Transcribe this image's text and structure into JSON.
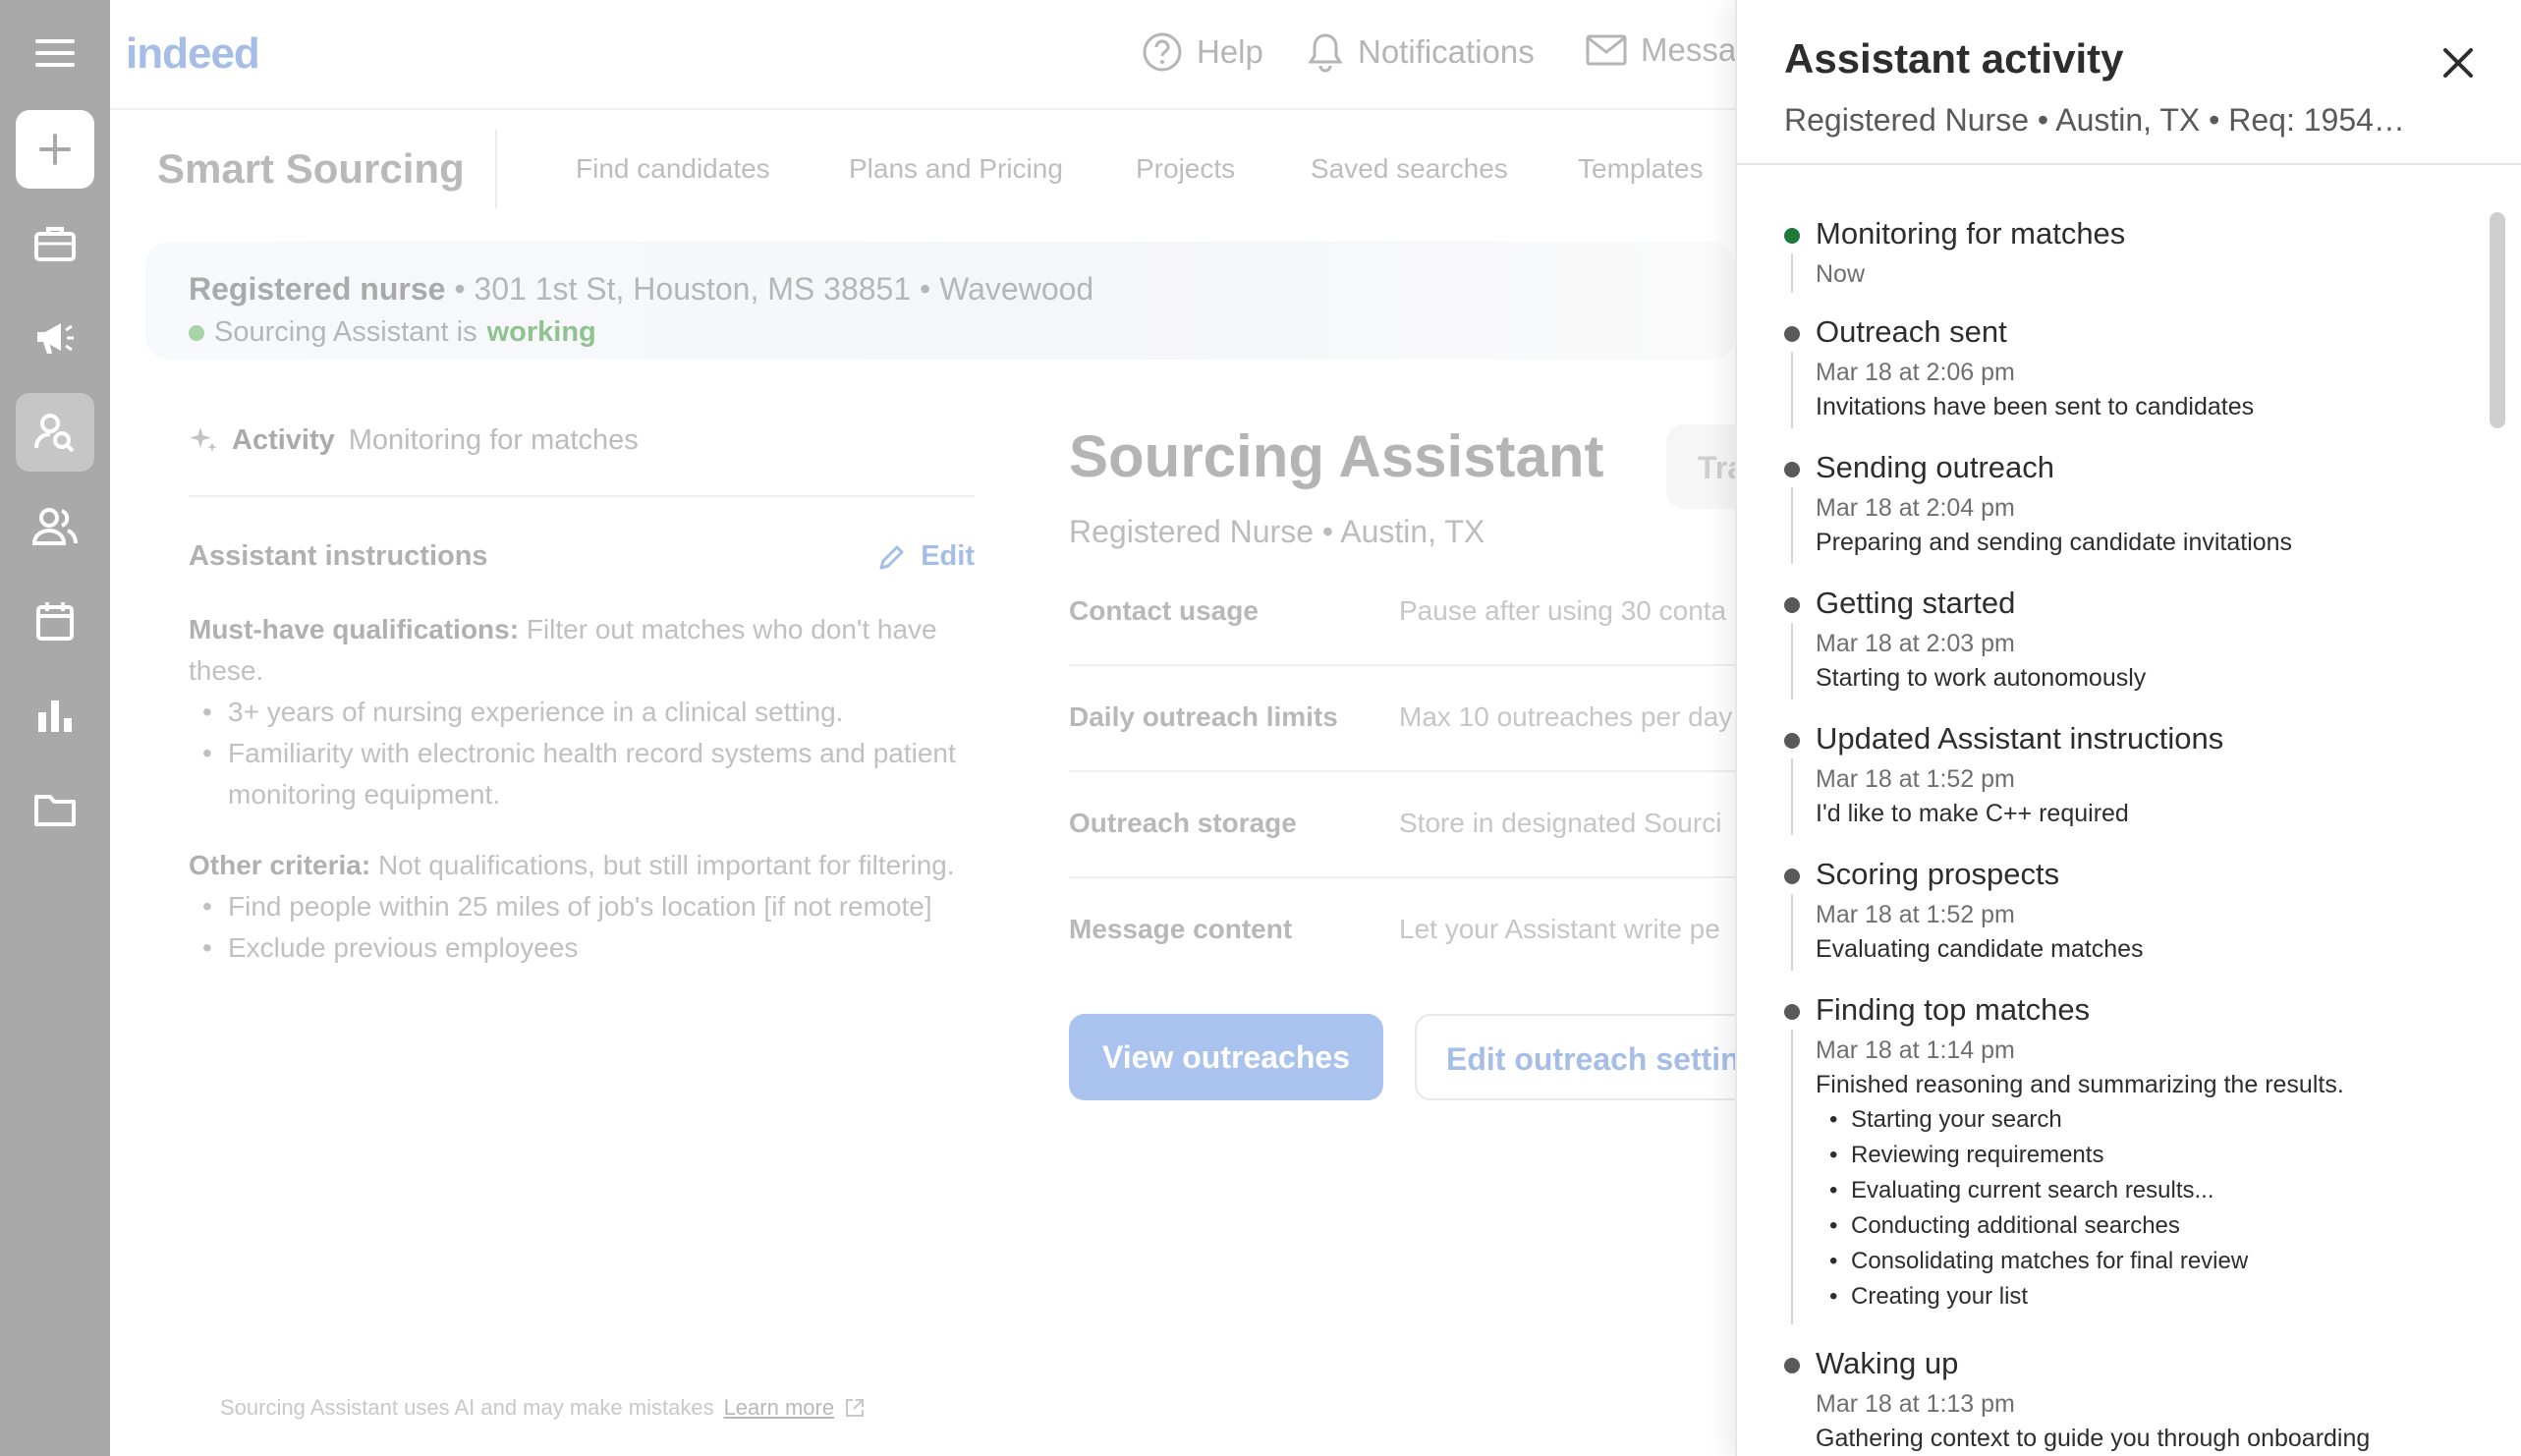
{
  "app": {
    "logo": "indeed"
  },
  "topbar": {
    "help": "Help",
    "notifications": "Notifications",
    "messages": "Messa"
  },
  "subnav": {
    "brand": "Smart Sourcing",
    "links": [
      "Find candidates",
      "Plans and Pricing",
      "Projects",
      "Saved searches",
      "Templates"
    ]
  },
  "job": {
    "title": "Registered nurse",
    "address": "• 301 1st St, Houston, MS 38851",
    "company": "• Wavewood",
    "status_prefix": "Sourcing Assistant is",
    "status_word": "working"
  },
  "activity": {
    "label": "Activity",
    "value": "Monitoring for matches"
  },
  "instructions": {
    "heading": "Assistant instructions",
    "edit_label": "Edit",
    "must_label": "Must-have qualifications:",
    "must_text": "Filter out matches who don't have these.",
    "must_items": [
      "3+ years of nursing experience in a clinical setting.",
      "Familiarity with electronic health record systems and patient monitoring equipment."
    ],
    "other_label": "Other criteria:",
    "other_text": "Not qualifications, but still important for filtering.",
    "other_items": [
      "Find people within 25 miles of job's location [if not remote]",
      "Exclude previous employees"
    ]
  },
  "assistant": {
    "title": "Sourcing Assistant",
    "subtitle": "Registered Nurse • Austin, TX",
    "tab_partial": "Tra",
    "settings": [
      {
        "label": "Contact usage",
        "value": "Pause after using 30 conta"
      },
      {
        "label": "Daily outreach limits",
        "value": "Max 10 outreaches per day"
      },
      {
        "label": "Outreach storage",
        "value": "Store in designated Sourci"
      },
      {
        "label": "Message content",
        "value": "Let your Assistant write pe"
      }
    ],
    "primary_button": "View outreaches",
    "secondary_button": "Edit outreach settin"
  },
  "footer": {
    "note": "Sourcing Assistant uses AI and may make mistakes",
    "link": "Learn more"
  },
  "drawer": {
    "title": "Assistant activity",
    "subtitle": "Registered Nurse • Austin, TX • Req: 1954…",
    "events": [
      {
        "title": "Monitoring for matches",
        "time": "Now",
        "desc": "",
        "items": [],
        "status": "active"
      },
      {
        "title": "Outreach sent",
        "time": "Mar 18 at 2:06 pm",
        "desc": "Invitations have been sent to candidates",
        "items": []
      },
      {
        "title": "Sending outreach",
        "time": "Mar 18 at 2:04 pm",
        "desc": "Preparing and sending candidate invitations",
        "items": []
      },
      {
        "title": "Getting started",
        "time": "Mar 18 at 2:03 pm",
        "desc": "Starting to work autonomously",
        "items": []
      },
      {
        "title": "Updated Assistant instructions",
        "time": "Mar 18 at 1:52 pm",
        "desc": "I'd like to make C++ required",
        "items": []
      },
      {
        "title": "Scoring prospects",
        "time": "Mar 18 at 1:52 pm",
        "desc": "Evaluating candidate matches",
        "items": []
      },
      {
        "title": "Finding top matches",
        "time": "Mar 18 at 1:14 pm",
        "desc": "Finished reasoning and summarizing the results.",
        "items": [
          "Starting your search",
          "Reviewing requirements",
          "Evaluating current search results...",
          "Conducting additional searches",
          "Consolidating matches for final review",
          "Creating your list"
        ]
      },
      {
        "title": "Waking up",
        "time": "Mar 18 at 1:13 pm",
        "desc": "Gathering context to guide you through onboarding",
        "items": []
      }
    ]
  },
  "colors": {
    "accent": "#2557a7",
    "active_dot": "#1f7a33",
    "rail": "#a9a9a9"
  }
}
